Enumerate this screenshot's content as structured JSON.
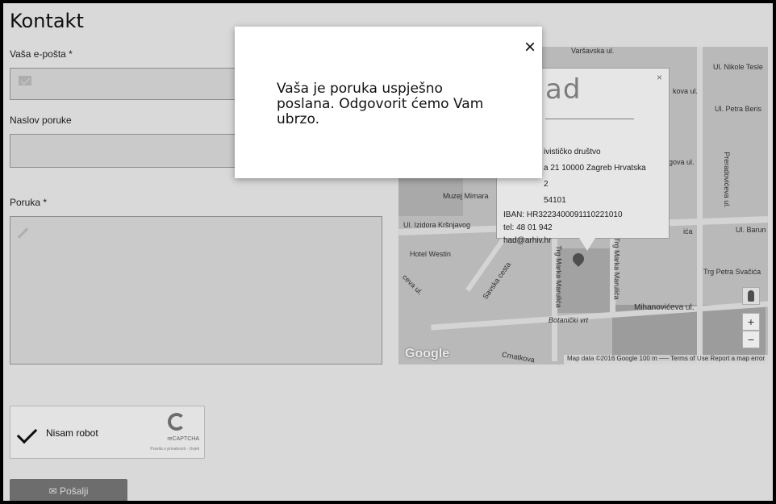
{
  "page": {
    "title": "Kontakt",
    "email_label": "Vaša e-pošta *",
    "subject_label": "Naslov poruke",
    "message_label": "Poruka *",
    "send_label": "✉ Pošalji"
  },
  "captcha": {
    "label": "Nisam robot",
    "brand": "reCAPTCHA",
    "links": "Pravila o privatnosti - Uvjeti"
  },
  "modal": {
    "message": "Vaša je poruka uspješno poslana. Odgovorit ćemo Vam ubrzo.",
    "close": "×"
  },
  "map": {
    "streets": {
      "varsavska": "Varšavska ul.",
      "nikole_tesle": "Ul. Nikole Tesle",
      "petra_berislavica": "Ul. Petra Beris",
      "gundulica": "ngova ul.",
      "preradoviceva": "Preradovićeva ul.",
      "baruna": "Ul. Barun",
      "krsnjavog": "Ul. Izidora Kršnjavog",
      "savska": "Savska cesta",
      "mihanoviceva": "Mihanovićeva ul.",
      "trg_marulica": "Trg Marka Marulića",
      "trg_marulica2": "Trg Marka Marulića",
      "crnatkova": "Crnatkova",
      "trg_svacica": "Trg Petra Svačića",
      "kova": "kova ul.",
      "ica": "ića",
      "ceva": "ceva ul."
    },
    "places": {
      "muzej": "Muzej Mimara",
      "hotel": "Hotel Westin",
      "botanicki": "Botanički vrt"
    },
    "google": "Google",
    "footer": "Map data ©2016 Google   100 m ⎯⎯⎯   Terms of Use   Report a map error",
    "zoom_in": "+",
    "zoom_out": "−",
    "info": {
      "logo": "ad",
      "close": "×",
      "line1": "ivističko društvo",
      "line2": "a 21 10000 Zagreb Hrvatska",
      "line3": "2",
      "line4": "54101",
      "iban": "IBAN: HR3223400091110221010",
      "tel": "tel: 48 01 942",
      "email": "had@arhiv.hr"
    }
  }
}
